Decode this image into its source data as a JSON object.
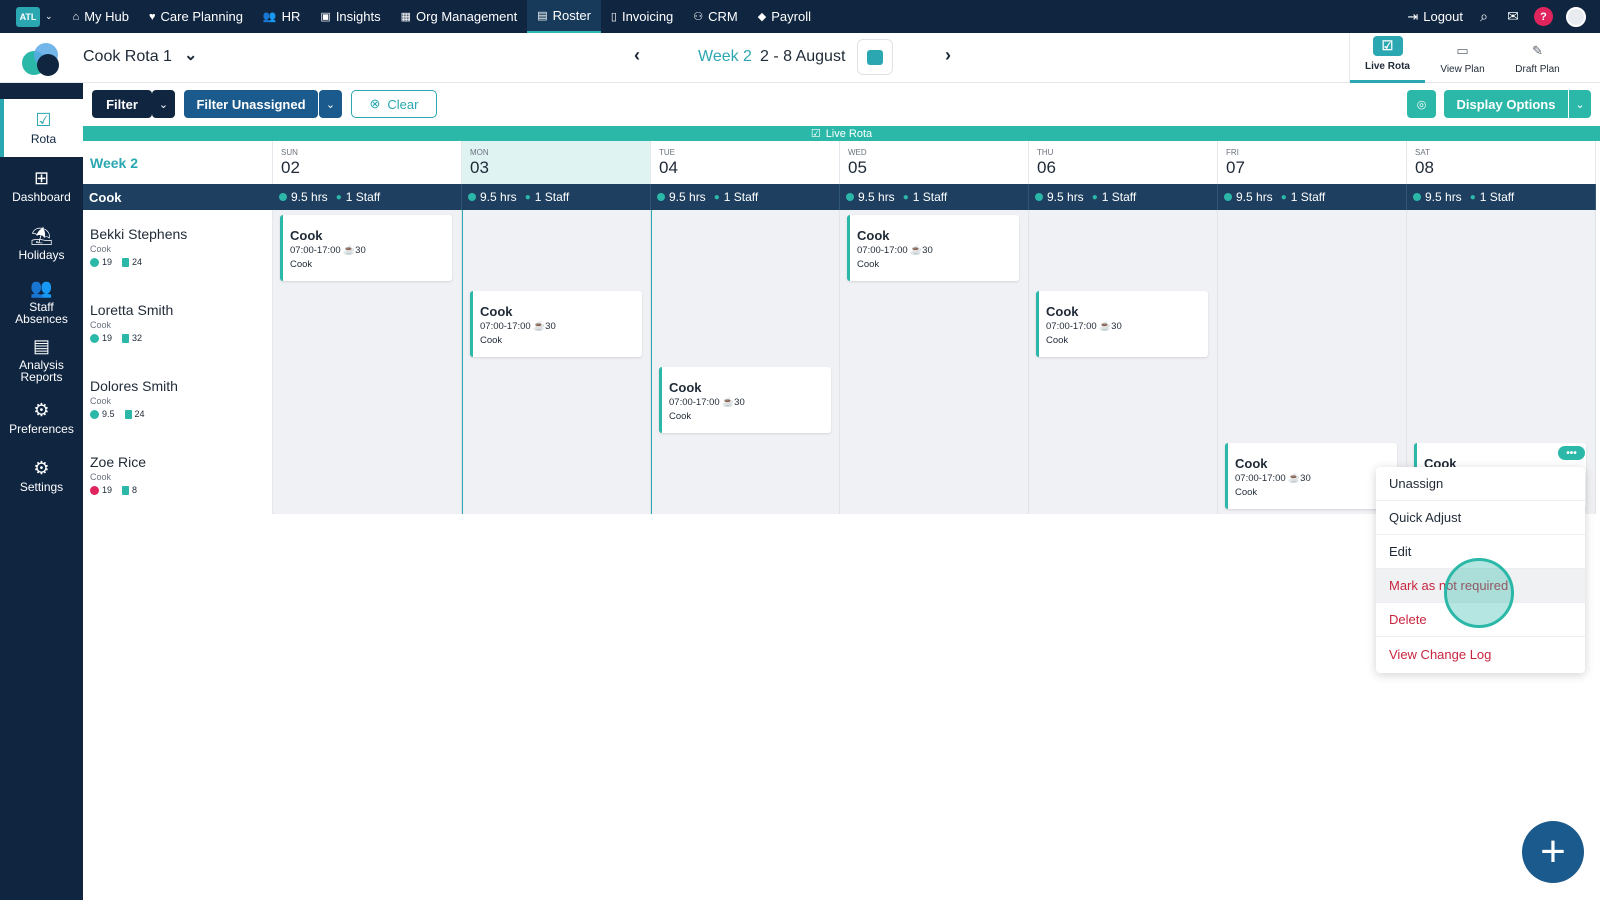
{
  "topnav": {
    "org_badge": "ATL",
    "items": [
      {
        "label": "My Hub",
        "icon": "⌂"
      },
      {
        "label": "Care Planning",
        "icon": "♥"
      },
      {
        "label": "HR",
        "icon": "👥"
      },
      {
        "label": "Insights",
        "icon": "▣"
      },
      {
        "label": "Org Management",
        "icon": "▦"
      },
      {
        "label": "Roster",
        "icon": "▤"
      },
      {
        "label": "Invoicing",
        "icon": "▯"
      },
      {
        "label": "CRM",
        "icon": "⚇"
      },
      {
        "label": "Payroll",
        "icon": "◆"
      }
    ],
    "logout": "Logout",
    "help": "?"
  },
  "header": {
    "rota_title": "Cook Rota 1",
    "week_label": "Week 2",
    "week_range": "2 - 8 August",
    "plan_tabs": [
      {
        "label": "Live Rota",
        "icon": "☑"
      },
      {
        "label": "View Plan",
        "icon": "▭"
      },
      {
        "label": "Draft Plan",
        "icon": "✎"
      }
    ]
  },
  "sidebar": {
    "items": [
      {
        "label": "Rota",
        "icon": "☑"
      },
      {
        "label": "Dashboard",
        "icon": "⊞"
      },
      {
        "label": "Holidays",
        "icon": "⛱"
      },
      {
        "label": "Staff\nAbsences",
        "icon": "👥"
      },
      {
        "label": "Analysis\nReports",
        "icon": "▤"
      },
      {
        "label": "Preferences",
        "icon": "⚙"
      },
      {
        "label": "Settings",
        "icon": "⚙"
      }
    ]
  },
  "filters": {
    "filter": "Filter",
    "filter_unassigned": "Filter Unassigned",
    "clear": "Clear",
    "display_options": "Display Options"
  },
  "live_strip": "Live Rota",
  "grid": {
    "week_label": "Week 2",
    "role": "Cook",
    "days": [
      {
        "name": "SUN",
        "num": "02"
      },
      {
        "name": "MON",
        "num": "03"
      },
      {
        "name": "TUE",
        "num": "04"
      },
      {
        "name": "WED",
        "num": "05"
      },
      {
        "name": "THU",
        "num": "06"
      },
      {
        "name": "FRI",
        "num": "07"
      },
      {
        "name": "SAT",
        "num": "08"
      }
    ],
    "summary": {
      "hours": "9.5 hrs",
      "staff": "1 Staff"
    },
    "employees": [
      {
        "name": "Bekki Stephens",
        "role": "Cook",
        "stat1": "19",
        "stat2": "24",
        "alert": false
      },
      {
        "name": "Loretta Smith",
        "role": "Cook",
        "stat1": "19",
        "stat2": "32",
        "alert": false
      },
      {
        "name": "Dolores Smith",
        "role": "Cook",
        "stat1": "9.5",
        "stat2": "24",
        "alert": false
      },
      {
        "name": "Zoe Rice",
        "role": "Cook",
        "stat1": "19",
        "stat2": "8",
        "alert": true
      }
    ],
    "shift": {
      "title": "Cook",
      "time": "07:00-17:00 ☕30",
      "role": "Cook"
    }
  },
  "menu": {
    "more": "•••",
    "items": [
      "Unassign",
      "Quick Adjust",
      "Edit",
      "Mark as not required",
      "Delete",
      "View Change Log"
    ]
  },
  "fab": "+"
}
